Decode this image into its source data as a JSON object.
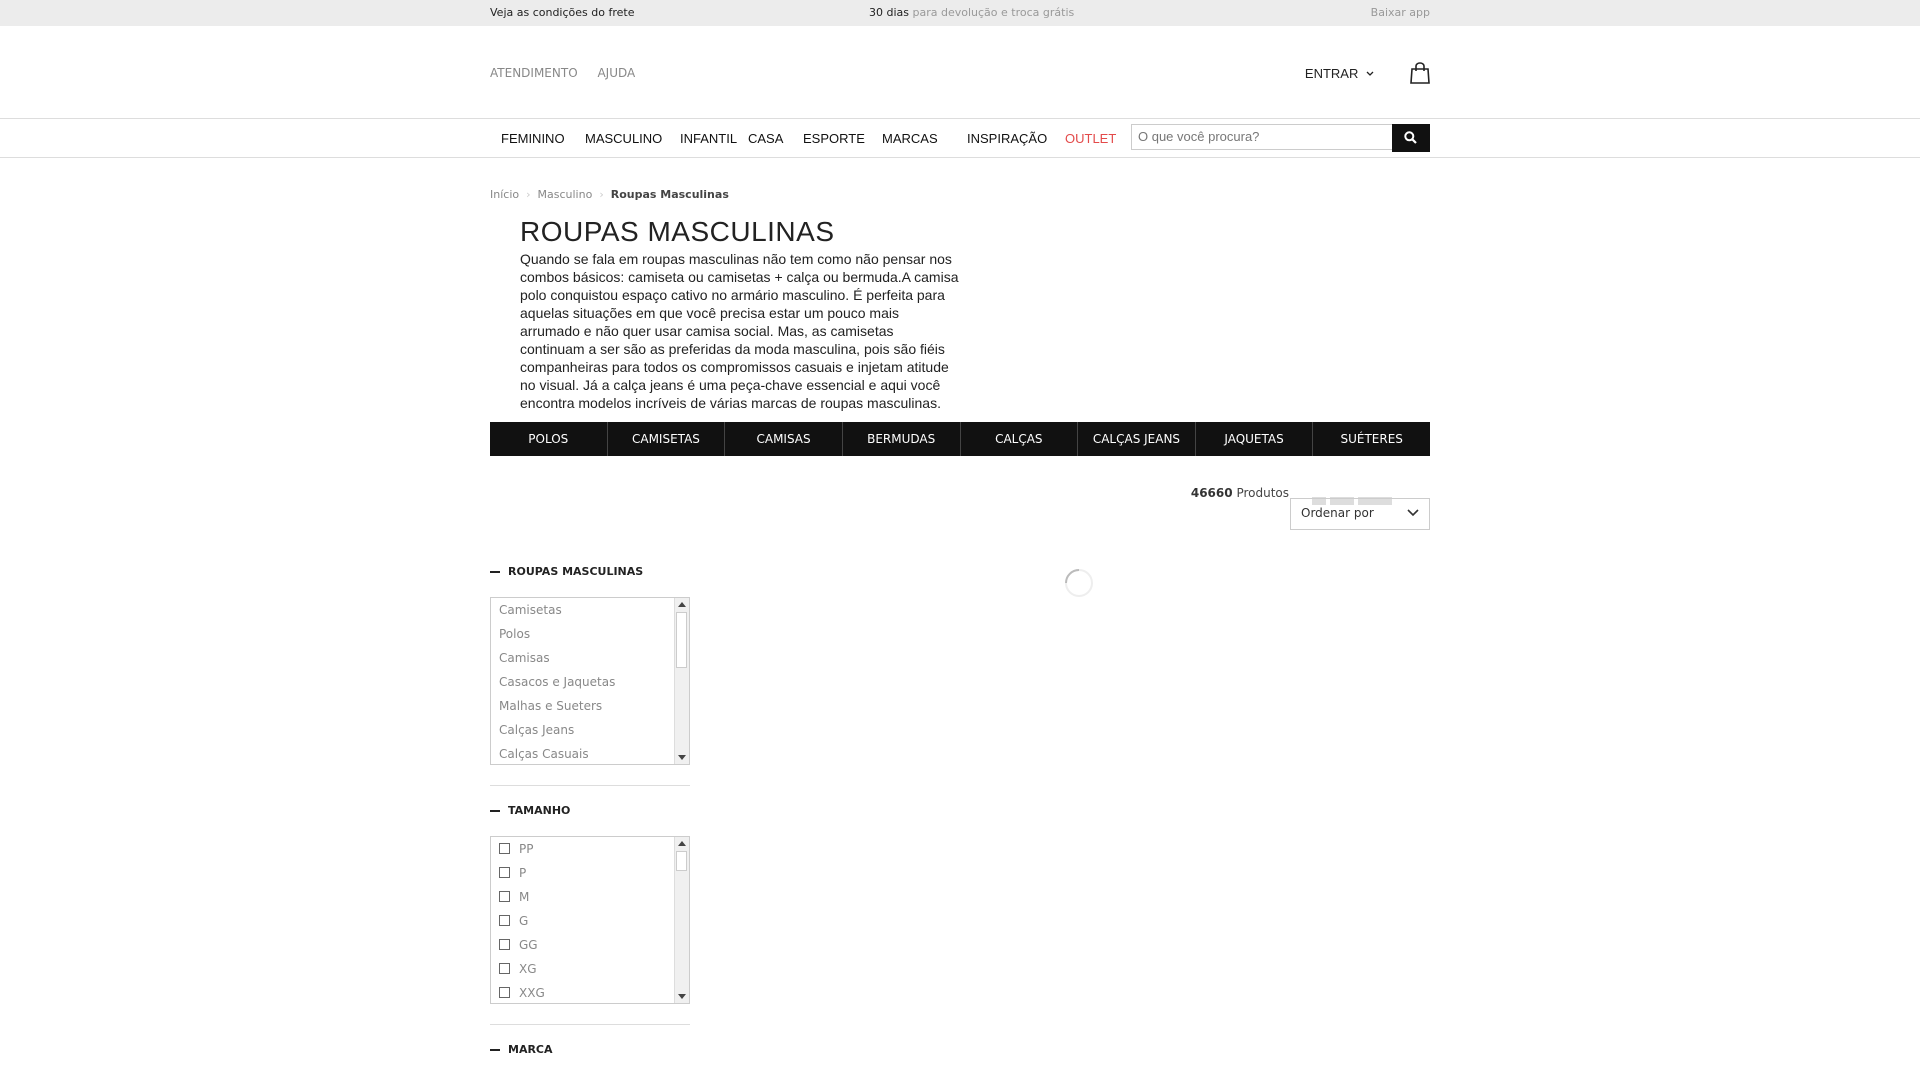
{
  "topbar": {
    "shipping": "Veja as condições do frete",
    "returns_bold": "30 dias",
    "returns_rest": " para devolução e troca grátis",
    "app": "Baixar app"
  },
  "header": {
    "links": [
      "ATENDIMENTO",
      "AJUDA"
    ],
    "login": "ENTRAR"
  },
  "nav": {
    "items": [
      "FEMININO",
      "MASCULINO",
      "INFANTIL",
      "CASA",
      "ESPORTE",
      "MARCAS",
      "INSPIRAÇÃO",
      "OUTLET"
    ],
    "search_placeholder": "O que você procura?"
  },
  "breadcrumb": [
    "Início",
    "Masculino",
    "Roupas Masculinas"
  ],
  "page": {
    "title": "ROUPAS MASCULINAS",
    "description": "Quando se fala em roupas masculinas não tem como não pensar nos combos básicos: camiseta ou camisetas + calça ou bermuda.A camisa polo conquistou espaço cativo no armário masculino. É perfeita para aquelas situações em que você precisa estar um pouco mais arrumado e não quer usar camisa social. Mas, as camisetas continuam a ser são as preferidas da moda masculina, pois são fiéis companheiras para todos os compromissos casuais e injetam atitude no visual. Já a calça jeans é uma peça-chave essencial e aqui você encontra modelos incríveis de várias marcas de roupas masculinas. São versáteis e acompanham qualquer compromisso."
  },
  "categories": [
    "POLOS",
    "CAMISETAS",
    "CAMISAS",
    "BERMUDAS",
    "CALÇAS",
    "CALÇAS JEANS",
    "JAQUETAS",
    "SUÉTERES"
  ],
  "results": {
    "count": "46660",
    "label": "Produtos",
    "sort": "Ordenar por"
  },
  "facets": {
    "category": {
      "title": "ROUPAS MASCULINAS",
      "items": [
        "Camisetas",
        "Polos",
        "Camisas",
        "Casacos e Jaquetas",
        "Malhas e Sueters",
        "Calças Jeans",
        "Calças Casuais"
      ]
    },
    "size": {
      "title": "TAMANHO",
      "items": [
        "PP",
        "P",
        "M",
        "G",
        "GG",
        "XG",
        "XXG"
      ]
    },
    "brand": {
      "title": "MARCA"
    }
  },
  "icons": {
    "bag": "shopping-bag-icon",
    "search": "search-icon",
    "chevron": "chevron-down-icon",
    "spinner": "loading-spinner-icon"
  },
  "colors": {
    "outlet": "#e34a4a",
    "catbar": "#111111",
    "topbar": "#ececec"
  }
}
